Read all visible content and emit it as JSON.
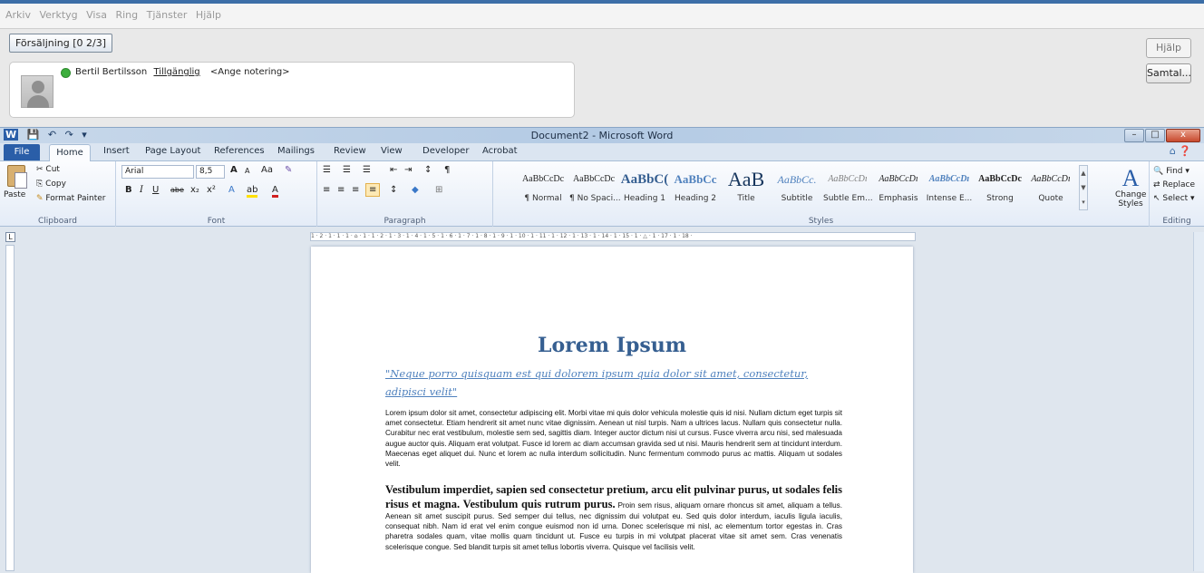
{
  "app": {
    "menu": [
      "Arkiv",
      "Verktyg",
      "Visa",
      "Ring",
      "Tjänster",
      "Hjälp"
    ],
    "sales_tab": "Försäljning [0 2/3]",
    "help_button": "Hjälp",
    "calls_button": "Samtal...",
    "contact": {
      "name": "Bertil Bertilsson",
      "status": "Tillgänglig",
      "note": "<Ange notering>"
    }
  },
  "word": {
    "quick_access": [
      "W",
      "💾",
      "↶",
      "↷",
      "▾"
    ],
    "title": "Document2 - Microsoft Word",
    "window_buttons": [
      "–",
      "□",
      "x"
    ],
    "tabs": [
      "File",
      "Home",
      "Insert",
      "Page Layout",
      "References",
      "Mailings",
      "Review",
      "View",
      "Developer",
      "Acrobat"
    ],
    "ribbon_help": "⌂ ❓",
    "clipboard": {
      "paste": "Paste",
      "cut": "Cut",
      "copy": "Copy",
      "format_painter": "Format Painter",
      "label": "Clipboard"
    },
    "font": {
      "name": "Arial",
      "size": "8,5",
      "grow": "A",
      "shrink": "A",
      "case": "Aa",
      "clear": "✎",
      "bold": "B",
      "italic": "I",
      "underline": "U",
      "strike": "abe",
      "subscript": "x₂",
      "superscript": "x²",
      "effects": "A",
      "highlight": "ab",
      "color": "A",
      "label": "Font"
    },
    "paragraph": {
      "bullets": "☰",
      "numbering": "☰",
      "multilevel": "☰",
      "decrease_indent": "⇤",
      "increase_indent": "⇥",
      "sort": "↕",
      "pilcrow": "¶",
      "align_left": "≡",
      "center": "≡",
      "align_right": "≡",
      "justify": "≡",
      "line_spacing": "↕",
      "shading": "◆",
      "borders": "⊞",
      "label": "Paragraph"
    },
    "styles": [
      {
        "sample": "AaBbCcDc",
        "name": "¶ Normal"
      },
      {
        "sample": "AaBbCcDc",
        "name": "¶ No Spaci..."
      },
      {
        "sample": "AaBbC(",
        "name": "Heading 1"
      },
      {
        "sample": "AaBbCc",
        "name": "Heading 2"
      },
      {
        "sample": "AaB",
        "name": "Title"
      },
      {
        "sample": "AaBbCc.",
        "name": "Subtitle"
      },
      {
        "sample": "AaBbCcDı",
        "name": "Subtle Em..."
      },
      {
        "sample": "AaBbCcDı",
        "name": "Emphasis"
      },
      {
        "sample": "AaBbCcDı",
        "name": "Intense E..."
      },
      {
        "sample": "AaBbCcDc",
        "name": "Strong"
      },
      {
        "sample": "AaBbCcDı",
        "name": "Quote"
      }
    ],
    "styles_label": "Styles",
    "change_styles": "Change Styles",
    "editing": {
      "find": "Find",
      "replace": "Replace",
      "select": "Select",
      "label": "Editing"
    },
    "ruler_text": "1 · 2 · 1 · 1 · 1 · ⌂ · 1 · 1 · 2 · 1 · 3 · 1 · 4 · 1 · 5 · 1 · 6 · 1 · 7 · 1 · 8 · 1 · 9 · 1 · 10 · 1 · 11 · 1 · 12 · 1 · 13 · 1 · 14 · 1 · 15 · 1 · △ · 1 · 17 · 1 · 18 ·",
    "tab_selector": "L"
  },
  "document": {
    "title": "Lorem Ipsum",
    "quote": "\"Neque porro quisquam est qui dolorem ipsum quia dolor sit amet, consectetur, adipisci velit\"",
    "paragraph1": "Lorem ipsum dolor sit amet, consectetur adipiscing elit. Morbi vitae mi quis dolor vehicula molestie quis id nisi. Nullam dictum eget turpis sit amet consectetur. Etiam hendrerit sit amet nunc vitae dignissim. Aenean ut nisl turpis. Nam a ultrices lacus. Nullam quis consectetur nulla. Curabitur nec erat vestibulum, molestie sem sed, sagittis diam. Integer auctor dictum nisi ut cursus. Fusce viverra arcu nisi, sed malesuada augue auctor quis. Aliquam erat volutpat. Fusce id lorem ac diam accumsan gravida sed ut nisi. Mauris hendrerit sem at tincidunt interdum. Maecenas eget aliquet dui. Nunc et lorem ac nulla interdum sollicitudin. Nunc fermentum commodo purus ac mattis. Aliquam ut sodales velit.",
    "paragraph2_lead": "Vestibulum imperdiet, sapien sed consectetur pretium, arcu elit pulvinar purus, ut sodales felis risus et magna. Vestibulum quis rutrum purus.",
    "paragraph2_rest": "Proin sem risus, aliquam ornare rhoncus sit amet, aliquam a tellus. Aenean sit amet suscipit purus. Sed semper dui tellus, nec dignissim dui volutpat eu. Sed quis dolor interdum, iaculis ligula iaculis, consequat nibh. Nam id erat vel enim congue euismod non id urna. Donec scelerisque mi nisl, ac elementum tortor egestas in. Cras pharetra sodales quam, vitae mollis quam tincidunt ut. Fusce eu turpis in mi volutpat placerat vitae sit amet sem. Cras venenatis scelerisque congue. Sed blandit turpis sit amet tellus lobortis viverra. Quisque vel facilisis velit."
  },
  "colors": {
    "title_blue": "#365f91",
    "quote_blue": "#4f81bd",
    "file_tab": "#2a5ea8",
    "presence_green": "#3cae3c"
  }
}
